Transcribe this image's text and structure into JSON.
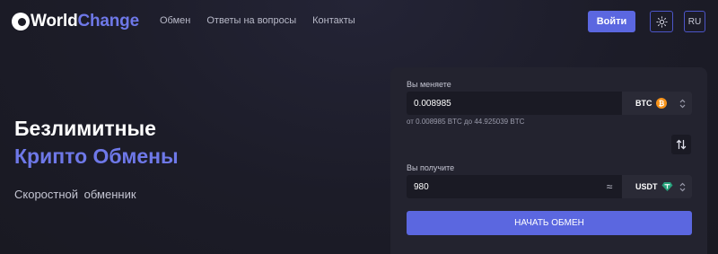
{
  "header": {
    "logo": {
      "part1": "World",
      "part2": "Change"
    },
    "nav": [
      "Обмен",
      "Ответы на вопросы",
      "Контакты"
    ],
    "login_label": "Войти",
    "theme_icon": "sun-icon",
    "lang_label": "RU"
  },
  "hero": {
    "title_line1": "Безлимитные",
    "title_line2": "Крипто Обмены",
    "subtitle": "Скоростной обменник"
  },
  "exchange": {
    "give_label": "Вы меняете",
    "give_value": "0.008985",
    "give_currency": "BTC",
    "give_currency_icon": "bitcoin-icon",
    "limits": "от 0.008985 BTC до 44.925039 BTC",
    "swap_icon": "swap-arrows-icon",
    "get_label": "Вы получите",
    "get_value": "980",
    "approx_symbol": "≈",
    "get_currency": "USDT",
    "get_currency_icon": "tether-icon",
    "start_label": "НАЧАТЬ ОБМЕН"
  },
  "colors": {
    "accent": "#5b67e0",
    "accent_text": "#6e78e8",
    "background": "#1c1c26",
    "card": "#23232f",
    "bitcoin": "#f7931a",
    "tether": "#26a17b"
  }
}
